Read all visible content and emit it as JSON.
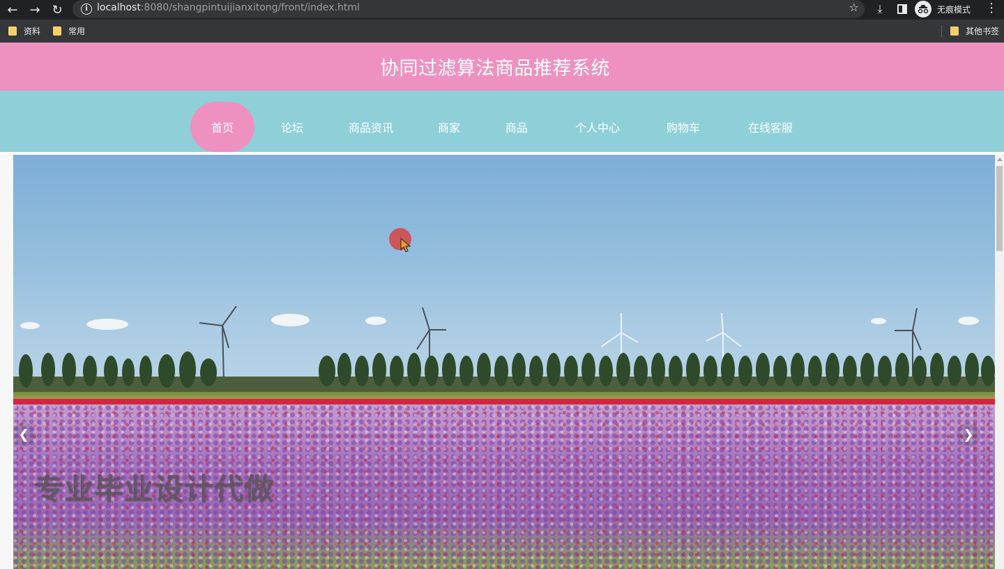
{
  "browser": {
    "url_host": "localhost",
    "url_rest": ":8080/shangpintuijianxitong/front/index.html",
    "incognito_label": "无痕模式",
    "bookmarks": [
      "资料",
      "常用"
    ],
    "other_bookmarks": "其他书签"
  },
  "site": {
    "title": "协同过滤算法商品推荐系统",
    "nav": [
      "首页",
      "论坛",
      "商品资讯",
      "商家",
      "商品",
      "个人中心",
      "购物车",
      "在线客服"
    ],
    "active_nav": "首页"
  },
  "banner": {
    "caption": "专业毕业设计代做"
  },
  "colors": {
    "header_bg": "#ee91c0",
    "nav_bg": "#8fd0d8",
    "active_nav_bg": "#ee91c0"
  },
  "icons": [
    "back-icon",
    "forward-icon",
    "reload-icon",
    "info-icon",
    "star-icon",
    "download-icon",
    "sidepanel-icon",
    "incognito-icon",
    "menu-icon",
    "folder-icon",
    "chevron-left-icon",
    "chevron-right-icon"
  ]
}
